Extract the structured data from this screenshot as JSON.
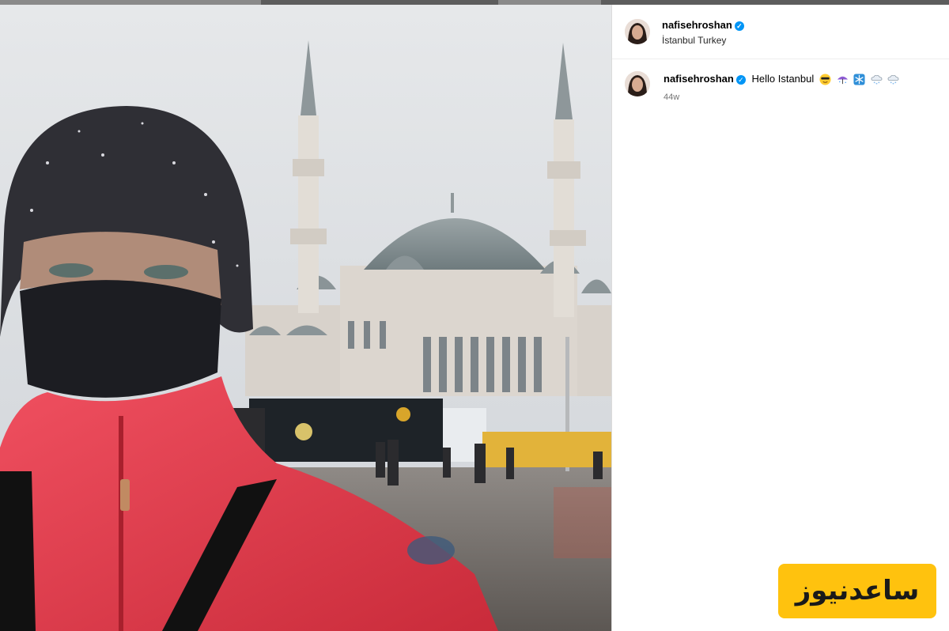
{
  "post": {
    "username": "nafisehroshan",
    "location": "İstanbul Turkey",
    "caption_text": "Hello Istanbul",
    "caption_emojis": [
      "sunglasses-emoji",
      "umbrella-emoji",
      "snowflake-emoji",
      "snow-cloud-emoji",
      "snow-cloud-emoji"
    ],
    "age": "44w",
    "verified": true
  },
  "watermark": {
    "text": "ساعدنیوز",
    "background": "#ffc20e"
  },
  "colors": {
    "verified_badge": "#0095f6",
    "jacket": "#e03a46",
    "sky": "#dcdfe3"
  },
  "icons": {
    "verified": "verified-badge-icon"
  }
}
